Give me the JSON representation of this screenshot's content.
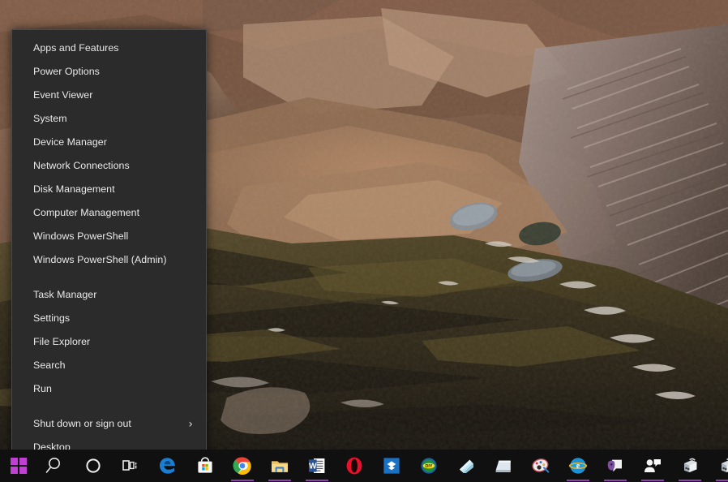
{
  "desktop": {
    "wallpaper_description": "Aerial photograph of rocky mountain terrain with scree slopes and two small alpine tarns",
    "wallpaper_colors": {
      "rock_light": "#c9a388",
      "rock_mid": "#8d6a53",
      "rock_dark": "#3b2c21",
      "terrain_olive": "#4a4026",
      "shadow": "#15100b",
      "sky_dark": "#1b2230",
      "lake": "#7f8c98",
      "snow": "#e8dfd6"
    }
  },
  "winx_menu": {
    "name": "Win+X Power User Menu",
    "background": "#2b2b2b",
    "text_color": "#e9e9e9",
    "groups": [
      {
        "id": "group-tools",
        "items": [
          {
            "label": "Apps and Features",
            "name": "apps-and-features"
          },
          {
            "label": "Power Options",
            "name": "power-options"
          },
          {
            "label": "Event Viewer",
            "name": "event-viewer"
          },
          {
            "label": "System",
            "name": "system"
          },
          {
            "label": "Device Manager",
            "name": "device-manager"
          },
          {
            "label": "Network Connections",
            "name": "network-connections"
          },
          {
            "label": "Disk Management",
            "name": "disk-management"
          },
          {
            "label": "Computer Management",
            "name": "computer-management"
          },
          {
            "label": "Windows PowerShell",
            "name": "windows-powershell"
          },
          {
            "label": "Windows PowerShell (Admin)",
            "name": "windows-powershell-admin"
          }
        ]
      },
      {
        "id": "group-system",
        "items": [
          {
            "label": "Task Manager",
            "name": "task-manager"
          },
          {
            "label": "Settings",
            "name": "settings"
          },
          {
            "label": "File Explorer",
            "name": "file-explorer"
          },
          {
            "label": "Search",
            "name": "search"
          },
          {
            "label": "Run",
            "name": "run"
          }
        ]
      },
      {
        "id": "group-session",
        "items": [
          {
            "label": "Shut down or sign out",
            "name": "shut-down-or-sign-out",
            "submenu": true,
            "chevron": "›"
          },
          {
            "label": "Desktop",
            "name": "desktop"
          }
        ]
      }
    ]
  },
  "taskbar": {
    "background": "#101010",
    "accent": "#a246c8",
    "start": {
      "label": "Start",
      "name": "start-button",
      "icon": "windows-logo-icon",
      "color": "#c23fd6"
    },
    "system_buttons": [
      {
        "label": "Search",
        "name": "search-icon",
        "icon": "magnifier-icon"
      },
      {
        "label": "Cortana",
        "name": "cortana-icon",
        "icon": "circle-icon"
      },
      {
        "label": "Task View",
        "name": "task-view-icon",
        "icon": "task-view-icon"
      }
    ],
    "apps": [
      {
        "label": "Microsoft Edge",
        "name": "taskbar-app-edge",
        "icon": "edge-icon",
        "running": false
      },
      {
        "label": "Microsoft Store",
        "name": "taskbar-app-microsoft-store",
        "icon": "store-bag-icon",
        "running": false
      },
      {
        "label": "Google Chrome",
        "name": "taskbar-app-chrome",
        "icon": "chrome-icon",
        "running": true
      },
      {
        "label": "File Explorer",
        "name": "taskbar-app-file-explorer",
        "icon": "folder-icon",
        "running": true
      },
      {
        "label": "Microsoft Word",
        "name": "taskbar-app-word",
        "icon": "word-icon",
        "running": true
      },
      {
        "label": "Opera",
        "name": "taskbar-app-opera",
        "icon": "opera-icon",
        "running": false
      },
      {
        "label": "Dropbox",
        "name": "taskbar-app-dropbox",
        "icon": "dropbox-icon",
        "running": false
      },
      {
        "label": "Utility",
        "name": "taskbar-app-green-badge",
        "icon": "green-badge-icon",
        "running": false
      },
      {
        "label": "Notes",
        "name": "taskbar-app-notes",
        "icon": "light-blue-page-icon",
        "running": false
      },
      {
        "label": "Scanner",
        "name": "taskbar-app-scanner",
        "icon": "scanner-icon",
        "running": false
      },
      {
        "label": "Paint Tool",
        "name": "taskbar-app-paint-tool",
        "icon": "palette-icon",
        "running": true
      },
      {
        "label": "Internet Explorer",
        "name": "taskbar-app-internet-explorer",
        "icon": "ie-icon",
        "running": true
      },
      {
        "label": "Media App",
        "name": "taskbar-app-media",
        "icon": "purple-media-icon",
        "running": true
      },
      {
        "label": "Messaging",
        "name": "taskbar-app-messaging",
        "icon": "person-chat-icon",
        "running": true
      },
      {
        "label": "Device Tool 1",
        "name": "taskbar-app-device-1",
        "icon": "device-box-icon",
        "running": true
      },
      {
        "label": "Device Tool 2",
        "name": "taskbar-app-device-2",
        "icon": "device-box-icon",
        "running": true
      }
    ]
  }
}
